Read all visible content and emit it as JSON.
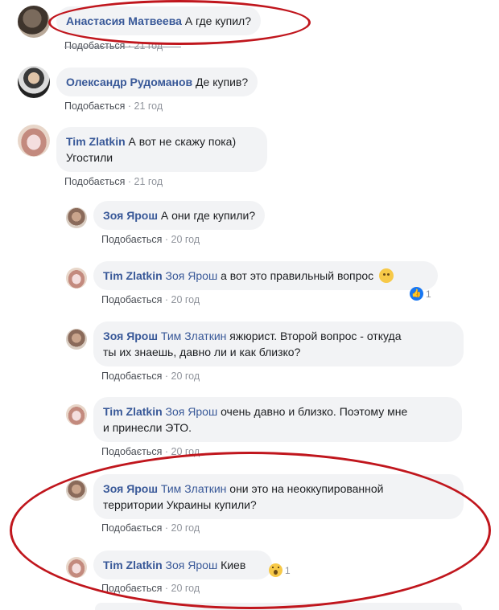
{
  "comments": [
    {
      "author": "Анастасия Матвеева",
      "text": "А где купил?",
      "like_label": "Подобається",
      "time": "21 год"
    },
    {
      "author": "Олександр Рудоманов",
      "text": "Де купив?",
      "like_label": "Подобається",
      "time": "21 год"
    },
    {
      "author": "Tim Zlatkin",
      "text": "А вот не скажу пока)",
      "text2": "Угостили",
      "like_label": "Подобається",
      "time": "21 год"
    },
    {
      "author": "Зоя Ярош",
      "text": "А они где купили?",
      "like_label": "Подобається",
      "time": "20 год"
    },
    {
      "author": "Tim Zlatkin",
      "mention": "Зоя Ярош",
      "text": "а вот это правильный вопрос",
      "like_label": "Подобається",
      "time": "20 год",
      "reaction_count": "1",
      "emoji": "smile-emoji"
    },
    {
      "author": "Зоя Ярош",
      "mention": "Тим Златкин",
      "text": "яжюрист. Второй вопрос - откуда",
      "text2": "ты их знаешь, давно ли и как близко?",
      "like_label": "Подобається",
      "time": "20 год"
    },
    {
      "author": "Tim Zlatkin",
      "mention": "Зоя Ярош",
      "text": "очень давно и близко. Поэтому мне",
      "text2": "и принесли ЭТО.",
      "like_label": "Подобається",
      "time": "20 год"
    },
    {
      "author": "Зоя Ярош",
      "mention": "Тим Златкин",
      "text": "они это на неоккупированной",
      "text2": "территории Украины купили?",
      "like_label": "Подобається",
      "time": "20 год"
    },
    {
      "author": "Tim Zlatkin",
      "mention": "Зоя Ярош",
      "text": "Киев",
      "like_label": "Подобається",
      "time": "20 год",
      "reaction_count": "1"
    }
  ],
  "meta_separator": "·",
  "colors": {
    "author": "#385898",
    "bubble": "#f2f3f5",
    "annotation": "#c0161d",
    "meta": "#90949c"
  }
}
